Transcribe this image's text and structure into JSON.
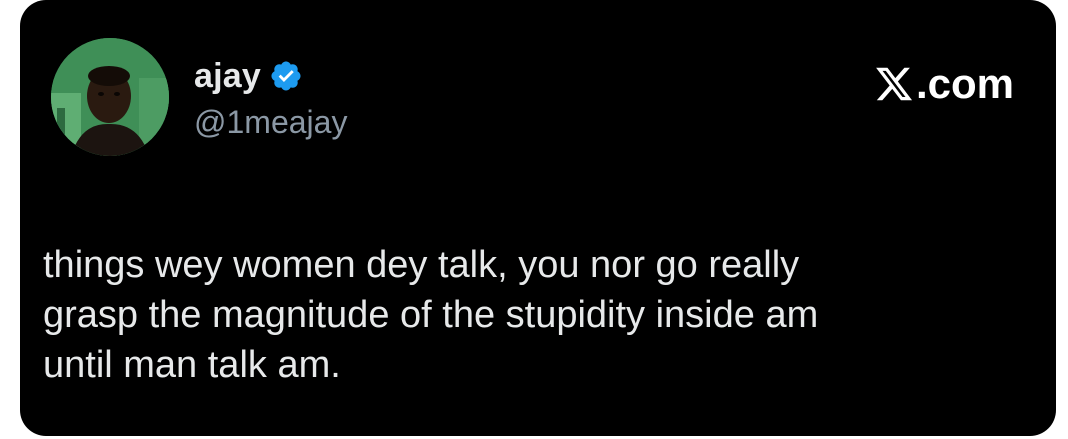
{
  "tweet": {
    "author": {
      "display_name": "ajay",
      "handle": "@1meajay",
      "verified_icon": "verified-badge-icon",
      "avatar": "profile-photo"
    },
    "source": {
      "logo_icon": "x-logo-icon",
      "label_suffix": ".com"
    },
    "text_lines": [
      "things wey women dey talk, you nor go really",
      "grasp the magnitude of the stupidity inside am",
      "until man talk am."
    ]
  },
  "colors": {
    "card_background": "#000000",
    "page_background": "#ffffff",
    "name_text": "#e7e9ea",
    "handle_text": "#8b98a5",
    "verified_blue": "#1d9bf0",
    "avatar_background": "#3d8a52"
  }
}
